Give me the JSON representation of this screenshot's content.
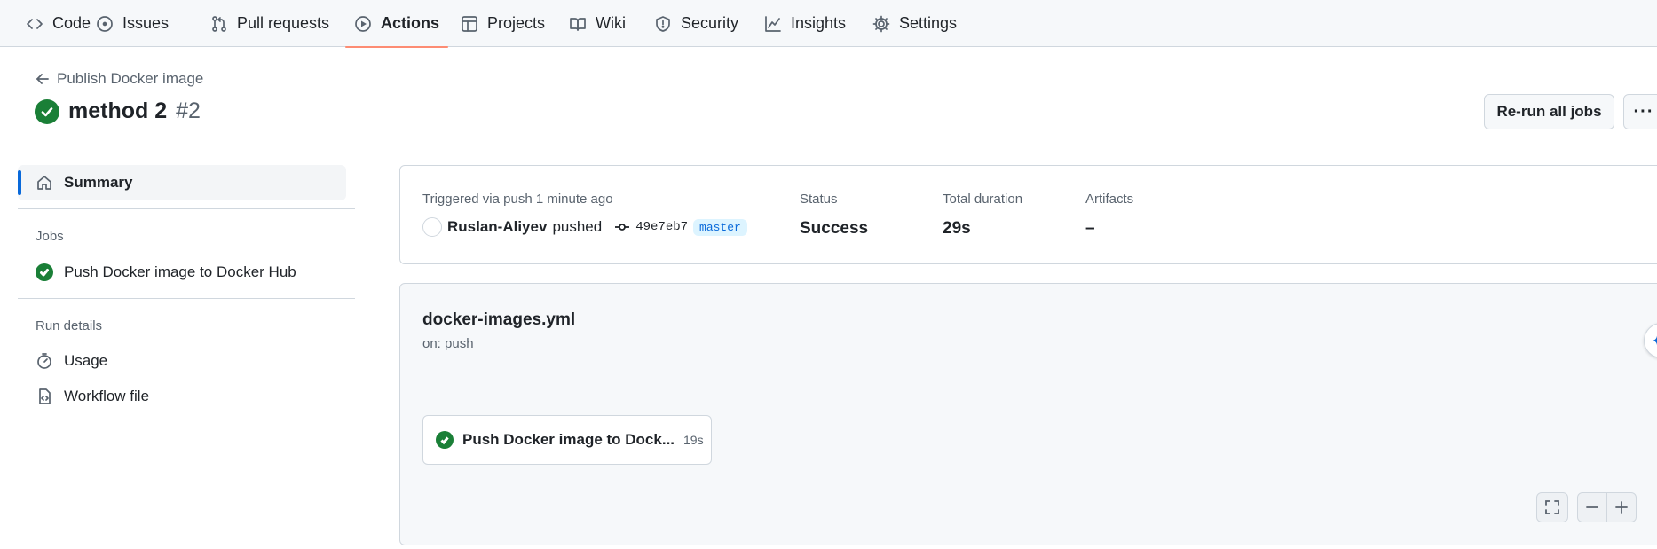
{
  "nav": {
    "tabs": [
      {
        "label": "Code",
        "icon": "code-icon"
      },
      {
        "label": "Issues",
        "icon": "issue-icon"
      },
      {
        "label": "Pull requests",
        "icon": "pull-request-icon"
      },
      {
        "label": "Actions",
        "icon": "play-icon",
        "active": true
      },
      {
        "label": "Projects",
        "icon": "table-icon"
      },
      {
        "label": "Wiki",
        "icon": "book-icon"
      },
      {
        "label": "Security",
        "icon": "shield-icon"
      },
      {
        "label": "Insights",
        "icon": "graph-icon"
      },
      {
        "label": "Settings",
        "icon": "gear-icon"
      }
    ]
  },
  "header": {
    "back_label": "Publish Docker image",
    "title": "method 2",
    "run_number": "#2",
    "rerun_label": "Re-run all jobs",
    "more_label": "···"
  },
  "sidebar": {
    "summary_label": "Summary",
    "jobs_heading": "Jobs",
    "jobs": [
      {
        "label": "Push Docker image to Docker Hub",
        "status": "success"
      }
    ],
    "run_details_heading": "Run details",
    "usage_label": "Usage",
    "workflow_file_label": "Workflow file"
  },
  "summary": {
    "trigger_label": "Triggered via push 1 minute ago",
    "actor": "Ruslan-Aliyev",
    "action": "pushed",
    "commit_sha": "49e7eb7",
    "branch": "master",
    "status_label": "Status",
    "status_value": "Success",
    "duration_label": "Total duration",
    "duration_value": "29s",
    "artifacts_label": "Artifacts",
    "artifacts_value": "–"
  },
  "graph": {
    "workflow_file": "docker-images.yml",
    "trigger": "on: push",
    "job_name": "Push Docker image to Dock...",
    "job_duration": "19s"
  },
  "colors": {
    "success": "#1a7f37",
    "accent": "#0969da",
    "active_tab_underline": "#fd8c73"
  }
}
